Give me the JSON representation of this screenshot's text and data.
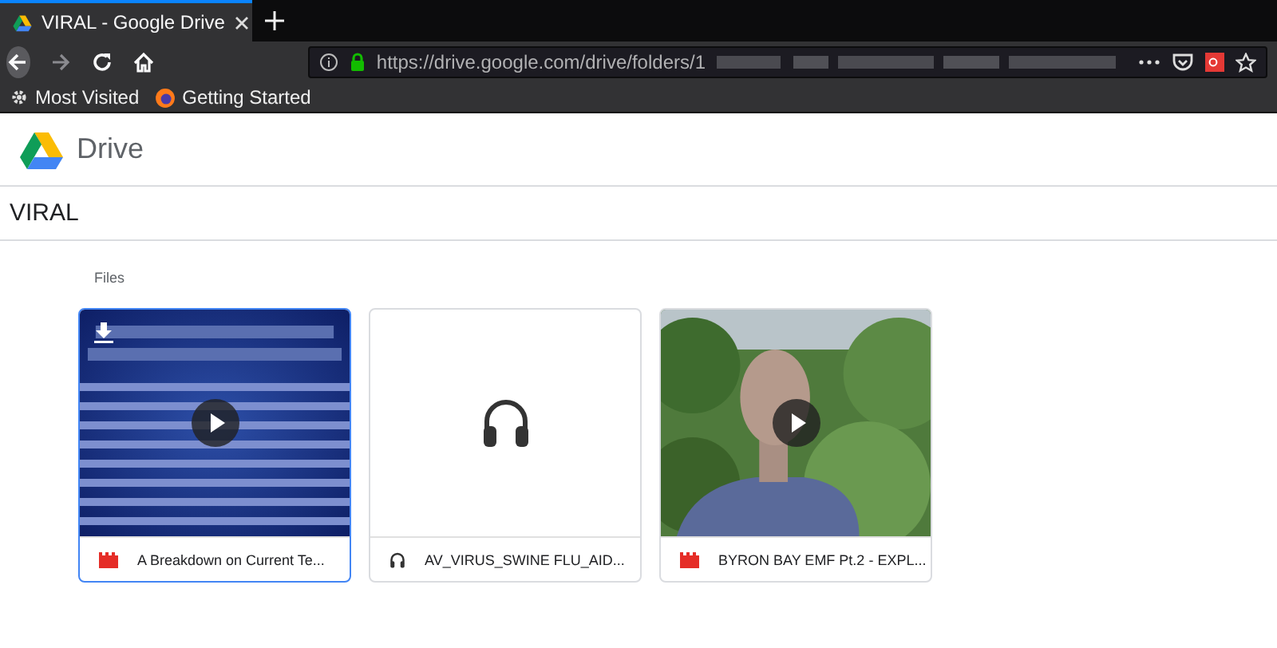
{
  "browser": {
    "tabs": [
      {
        "title": "VIRAL - Google Drive",
        "selected": true
      }
    ],
    "url": "https://drive.google.com/drive/folders/1",
    "bookmarks": [
      "Most Visited",
      "Getting Started"
    ]
  },
  "app": {
    "name": "Drive"
  },
  "folder": {
    "title": "VIRAL"
  },
  "section": "Files",
  "files": [
    {
      "kind": "video",
      "name": "A Breakdown on Current Te...",
      "selected": true
    },
    {
      "kind": "audio",
      "name": "AV_VIRUS_SWINE FLU_AID...",
      "selected": false
    },
    {
      "kind": "video",
      "name": "BYRON BAY EMF Pt.2 - EXPL...",
      "selected": false
    }
  ]
}
